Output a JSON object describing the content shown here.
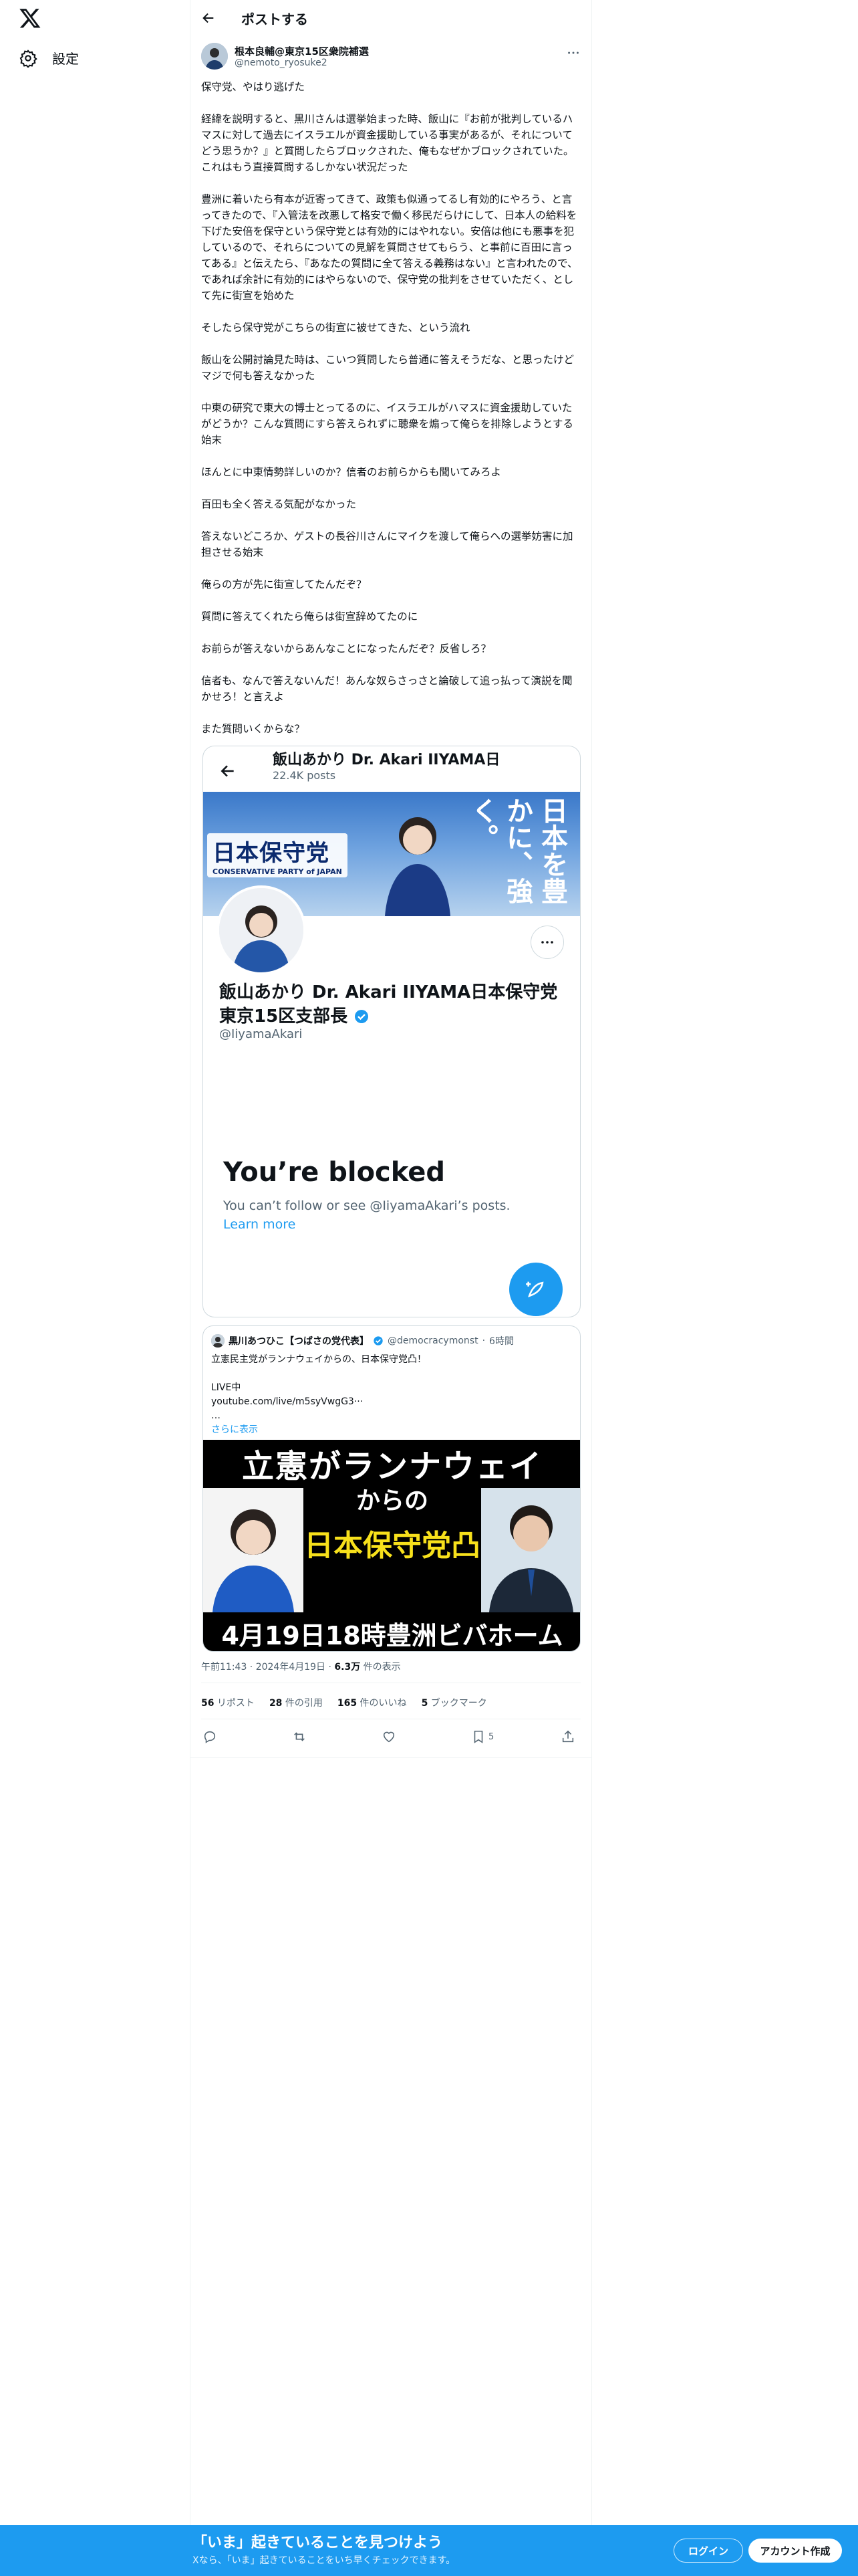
{
  "nav": {
    "settings_label": "設定"
  },
  "header": {
    "title": "ポストする"
  },
  "post": {
    "author_name": "根本良輔@東京15区衆院補選",
    "author_handle": "@nemoto_ryosuke2",
    "paragraphs": [
      "保守党、やはり逃げた",
      "経緯を説明すると、黒川さんは選挙始まった時、飯山に『お前が批判しているハマスに対して過去にイスラエルが資金援助している事実があるが、それについてどう思うか？』と質問したらブロックされた、俺もなぜかブロックされていた。これはもう直接質問するしかない状況だった",
      "豊洲に着いたら有本が近寄ってきて、政策も似通ってるし有効的にやろう、と言ってきたので、『入管法を改悪して格安で働く移民だらけにして、日本人の給料を下げた安倍を保守という保守党とは有効的にはやれない。安倍は他にも悪事を犯しているので、それらについての見解を質問させてもらう、と事前に百田に言ってある』と伝えたら、『あなたの質問に全て答える義務はない』と言われたので、であれば余計に有効的にはやらないので、保守党の批判をさせていただく、として先に街宣を始めた",
      "そしたら保守党がこちらの街宣に被せてきた、という流れ",
      "飯山を公開討論見た時は、こいつ質問したら普通に答えそうだな、と思ったけどマジで何も答えなかった",
      "中東の研究で東大の博士とってるのに、イスラエルがハマスに資金援助していたがどうか？こんな質問にすら答えられずに聴衆を煽って俺らを排除しようとする始末",
      "ほんとに中東情勢詳しいのか？信者のお前らからも聞いてみろよ",
      "百田も全く答える気配がなかった",
      "答えないどころか、ゲストの長谷川さんにマイクを渡して俺らへの選挙妨害に加担させる始末",
      "俺らの方が先に街宣してたんだぞ？",
      "質問に答えてくれたら俺らは街宣辞めてたのに",
      "お前らが答えないからあんなことになったんだぞ？反省しろ？",
      "信者も、なんで答えないんだ！あんな奴らさっさと論破して追っ払って演説を聞かせろ！と言えよ",
      "また質問いくからな？"
    ]
  },
  "screenshot_card": {
    "profile_name": "飯山あかり Dr. Akari IIYAMA日",
    "posts_count": "22.4K posts",
    "banner_party_jp": "日本保守党",
    "banner_party_en": "CONSERVATIVE PARTY of JAPAN",
    "banner_slogan": "日本を豊かに、強く。",
    "display_name": "飯山あかり Dr. Akari IIYAMA日本保守党東京15区支部長",
    "handle": "@IiyamaAkari",
    "blocked_title": "You’re blocked",
    "blocked_sub": "You can’t follow or see @IiyamaAkari’s posts.",
    "learn_more": "Learn more"
  },
  "quote": {
    "name": "黒川あつひこ【つばさの党代表】",
    "handle": "@democracymonst",
    "time": "6時間",
    "lines": [
      "立憲民主党がランナウェイからの、日本保守党凸！",
      "",
      "LIVE中",
      "youtube.com/live/m5syVwgG3···",
      "…"
    ],
    "show_more": "さらに表示",
    "thumb_line1": "立憲がランナウェイ",
    "thumb_line2": "からの",
    "thumb_line3": "日本保守党凸",
    "thumb_line4": "4月19日18時豊洲ビバホーム"
  },
  "meta": {
    "time": "午前11:43 · 2024年4月19日 · ",
    "views_num": "6.3万",
    "views_label": " 件の表示"
  },
  "stats": {
    "reposts_num": "56",
    "reposts_label": " リポスト",
    "quotes_num": "28",
    "quotes_label": " 件の引用",
    "likes_num": "165",
    "likes_label": " 件のいいね",
    "bookmarks_num": "5",
    "bookmarks_label": " ブックマーク"
  },
  "actions": {
    "bookmark_count": "5"
  },
  "bottom": {
    "title": "「いま」起きていることを見つけよう",
    "subtitle": "Xなら、「いま」起きていることをいち早くチェックできます。",
    "login": "ログイン",
    "signup": "アカウント作成"
  },
  "colors": {
    "accent": "#1d9bf0",
    "text": "#0f1419",
    "muted": "#536471"
  }
}
